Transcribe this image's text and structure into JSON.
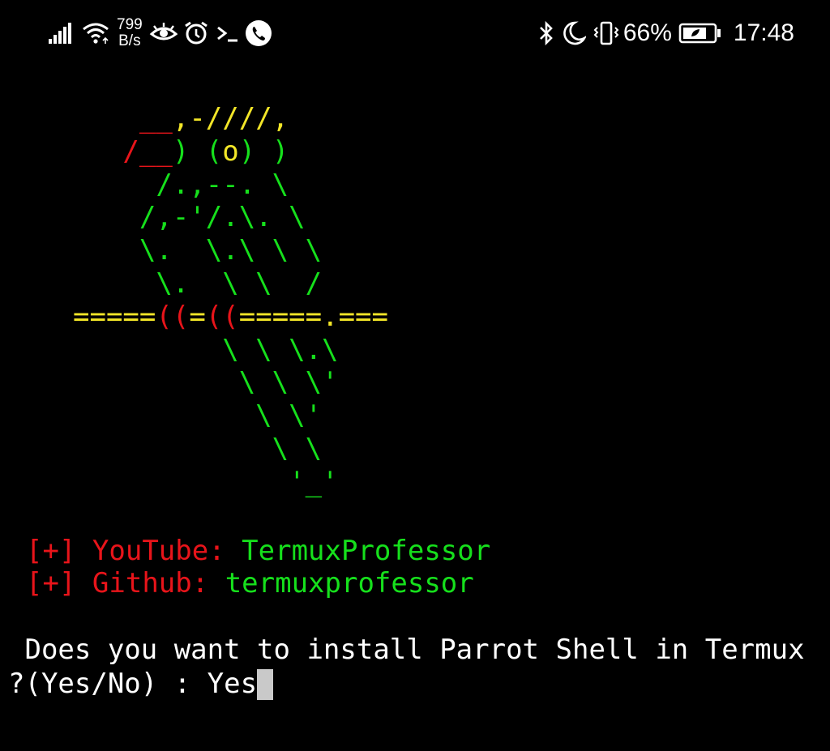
{
  "status_bar": {
    "net_speed_value": "799",
    "net_speed_unit": "B/s",
    "battery_percent": "66%",
    "time": "17:48",
    "icons_left": [
      "signal-icon",
      "wifi-icon",
      "eye-icon",
      "alarm-icon",
      "terminal-icon",
      "phone-icon"
    ],
    "icons_right": [
      "bluetooth-icon",
      "moon-icon",
      "vibrate-icon",
      "battery-icon"
    ]
  },
  "terminal": {
    "ascii_art": [
      [
        {
          "t": "    ",
          "c": "white"
        },
        {
          "t": "__",
          "c": "red"
        },
        {
          "t": ",-////,",
          "c": "yellow"
        }
      ],
      [
        {
          "t": "   ",
          "c": "white"
        },
        {
          "t": "/__",
          "c": "red"
        },
        {
          "t": ") (",
          "c": "green"
        },
        {
          "t": "o",
          "c": "yellow"
        },
        {
          "t": ") )",
          "c": "green"
        }
      ],
      [
        {
          "t": "     /.,--. \\",
          "c": "green"
        }
      ],
      [
        {
          "t": "    /,-'/.\\. \\",
          "c": "green"
        }
      ],
      [
        {
          "t": "    \\.  \\.\\ \\ \\",
          "c": "green"
        }
      ],
      [
        {
          "t": "     \\.  \\ \\  /",
          "c": "green"
        }
      ],
      [
        {
          "t": "=====",
          "c": "yellow"
        },
        {
          "t": "((",
          "c": "red"
        },
        {
          "t": "=",
          "c": "yellow"
        },
        {
          "t": "((",
          "c": "red"
        },
        {
          "t": "=====.===",
          "c": "yellow"
        }
      ],
      [
        {
          "t": "         \\ \\ \\.\\",
          "c": "green"
        }
      ],
      [
        {
          "t": "          \\ \\ \\'",
          "c": "green"
        }
      ],
      [
        {
          "t": "           \\ \\'",
          "c": "green"
        }
      ],
      [
        {
          "t": "            \\ \\",
          "c": "green"
        }
      ],
      [
        {
          "t": "             '_'",
          "c": "green"
        }
      ]
    ],
    "youtube": {
      "bullet": "[+]",
      "label": "YouTube:",
      "value": "TermuxProfessor"
    },
    "github": {
      "bullet": "[+]",
      "label": "Github:",
      "value": "termuxprofessor"
    },
    "prompt_line_1": " Does you want to install Parrot Shell in Termux",
    "prompt_line_2": "?(Yes/No) : ",
    "input_value": "Yes"
  },
  "colors": {
    "background": "#000000",
    "red": "#e8141a",
    "yellow": "#f3e628",
    "green": "#16e01c",
    "text": "#ffffff",
    "cursor": "#c9c9c9"
  }
}
